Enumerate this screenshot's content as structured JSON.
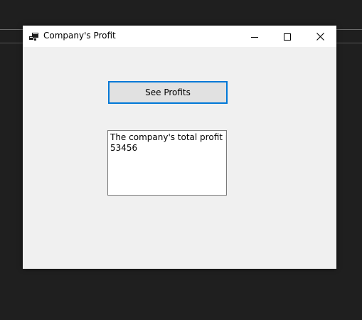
{
  "window": {
    "title": "Company's Profit",
    "icon": "windows-form-icon",
    "controls": {
      "minimize": "minimize-icon",
      "maximize": "maximize-icon",
      "close": "close-icon"
    }
  },
  "form": {
    "button_label": "See Profits",
    "output": {
      "line1": "The company's total profit is:",
      "line2": "53456"
    }
  },
  "colors": {
    "desktop": "#1f1f1f",
    "form_background": "#f0f0f0",
    "titlebar": "#ffffff",
    "button_focus_border": "#0078d7",
    "button_face": "#e1e1e1"
  }
}
